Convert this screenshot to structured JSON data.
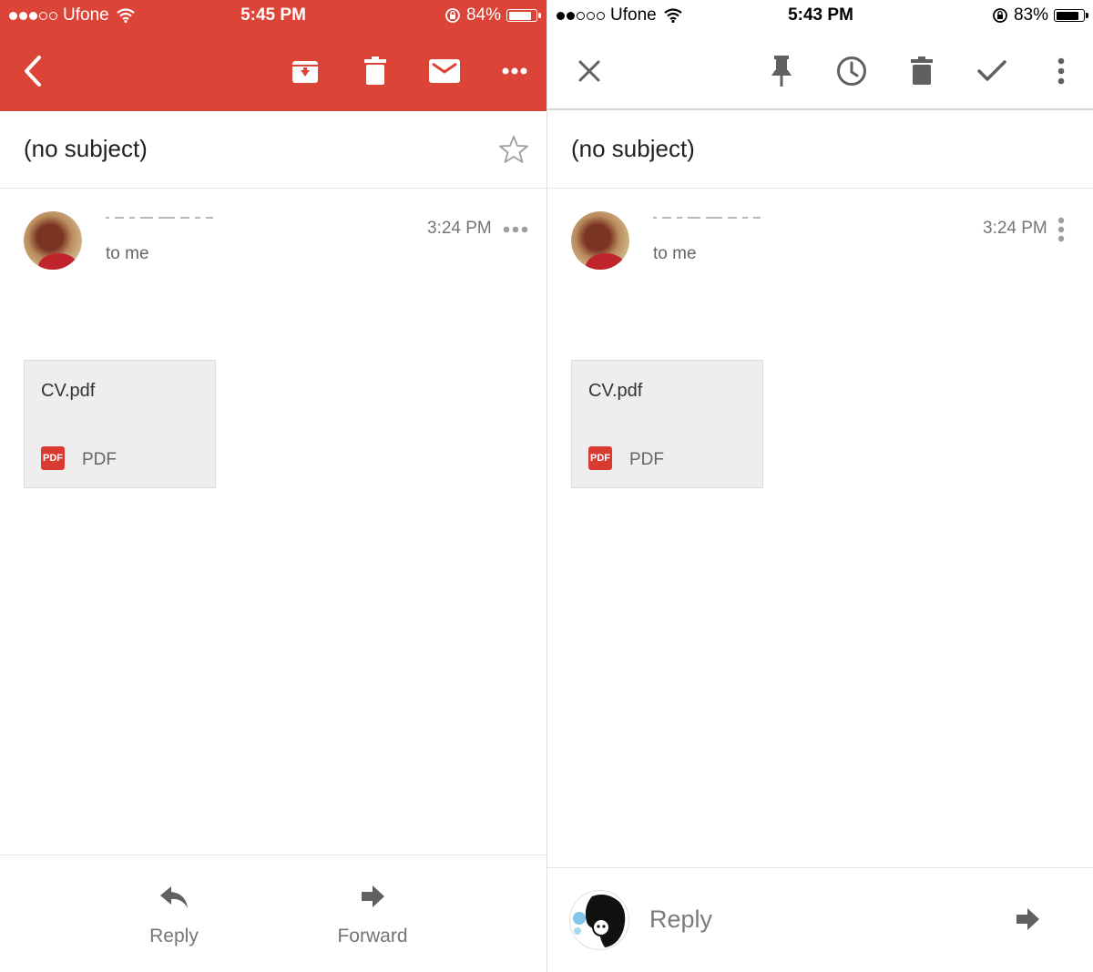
{
  "colors": {
    "accent": "#db4437",
    "icon_gray": "#606060"
  },
  "left": {
    "status": {
      "carrier": "Ufone",
      "time": "5:45 PM",
      "battery": "84%",
      "battery_level": 0.84
    },
    "toolbar": {
      "back_icon": "chevron-left-icon",
      "archive_icon": "archive-icon",
      "delete_icon": "trash-icon",
      "mark_unread_icon": "mail-icon",
      "more_icon": "more-horizontal-icon"
    },
    "email": {
      "subject": "(no subject)",
      "to_line": "to me",
      "time": "3:24 PM",
      "attachment": {
        "name": "CV.pdf",
        "badge": "PDF",
        "type": "PDF"
      }
    },
    "bottom": {
      "reply_label": "Reply",
      "forward_label": "Forward"
    }
  },
  "right": {
    "status": {
      "carrier": "Ufone",
      "time": "5:43 PM",
      "battery": "83%",
      "battery_level": 0.83
    },
    "toolbar": {
      "close_icon": "close-icon",
      "pin_icon": "pin-icon",
      "snooze_icon": "clock-icon",
      "delete_icon": "trash-icon",
      "done_icon": "check-icon",
      "more_icon": "more-vertical-icon"
    },
    "email": {
      "subject": "(no subject)",
      "to_line": "to me",
      "time": "3:24 PM",
      "attachment": {
        "name": "CV.pdf",
        "badge": "PDF",
        "type": "PDF"
      }
    },
    "bottom": {
      "reply_label": "Reply"
    }
  }
}
